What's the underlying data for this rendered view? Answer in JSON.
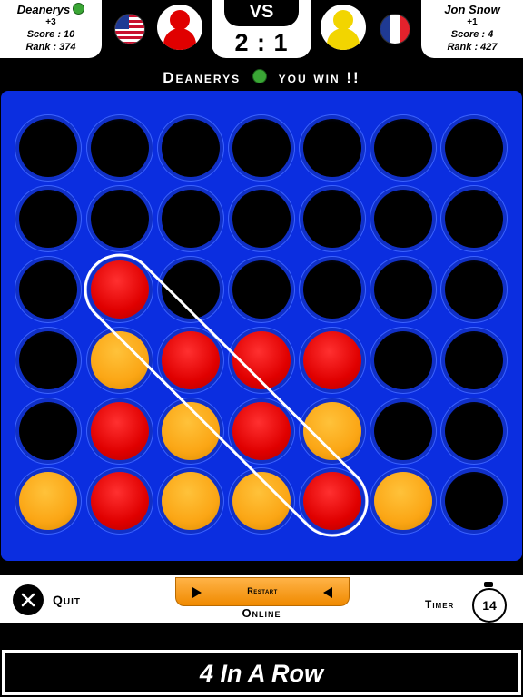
{
  "players": {
    "left": {
      "name": "Deanerys",
      "delta": "+3",
      "score": "Score : 10",
      "rank": "Rank : 374",
      "flag": "us-flag-icon",
      "disc_color": "#e00000"
    },
    "right": {
      "name": "Jon Snow",
      "delta": "+1",
      "score": "Score : 4",
      "rank": "Rank : 427",
      "flag": "fr-flag-icon",
      "disc_color": "#f2d500"
    }
  },
  "vs_label": "VS",
  "match_score": "2 : 1",
  "banner": {
    "winner": "Deanerys",
    "suffix": "you win !!"
  },
  "board": {
    "columns": 7,
    "rows": 6,
    "cells": [
      [
        "empty",
        "empty",
        "empty",
        "empty",
        "empty",
        "empty",
        "empty"
      ],
      [
        "empty",
        "empty",
        "empty",
        "empty",
        "empty",
        "empty",
        "empty"
      ],
      [
        "empty",
        "red",
        "empty",
        "empty",
        "empty",
        "empty",
        "empty"
      ],
      [
        "empty",
        "yellow",
        "red",
        "red",
        "red",
        "empty",
        "empty"
      ],
      [
        "empty",
        "red",
        "yellow",
        "red",
        "yellow",
        "empty",
        "empty"
      ],
      [
        "yellow",
        "red",
        "yellow",
        "yellow",
        "red",
        "yellow",
        "empty"
      ]
    ],
    "winning_line": [
      [
        2,
        1
      ],
      [
        3,
        2
      ],
      [
        4,
        3
      ],
      [
        5,
        4
      ]
    ],
    "colors": {
      "red": "#e00000",
      "yellow": "#fba615",
      "board": "#0b2ee0"
    }
  },
  "controls": {
    "quit_label": "Quit",
    "restart_label": "Restart",
    "mode_label": "Online",
    "timer_label": "Timer",
    "timer_value": "14"
  },
  "footer_title": "4 In A Row"
}
